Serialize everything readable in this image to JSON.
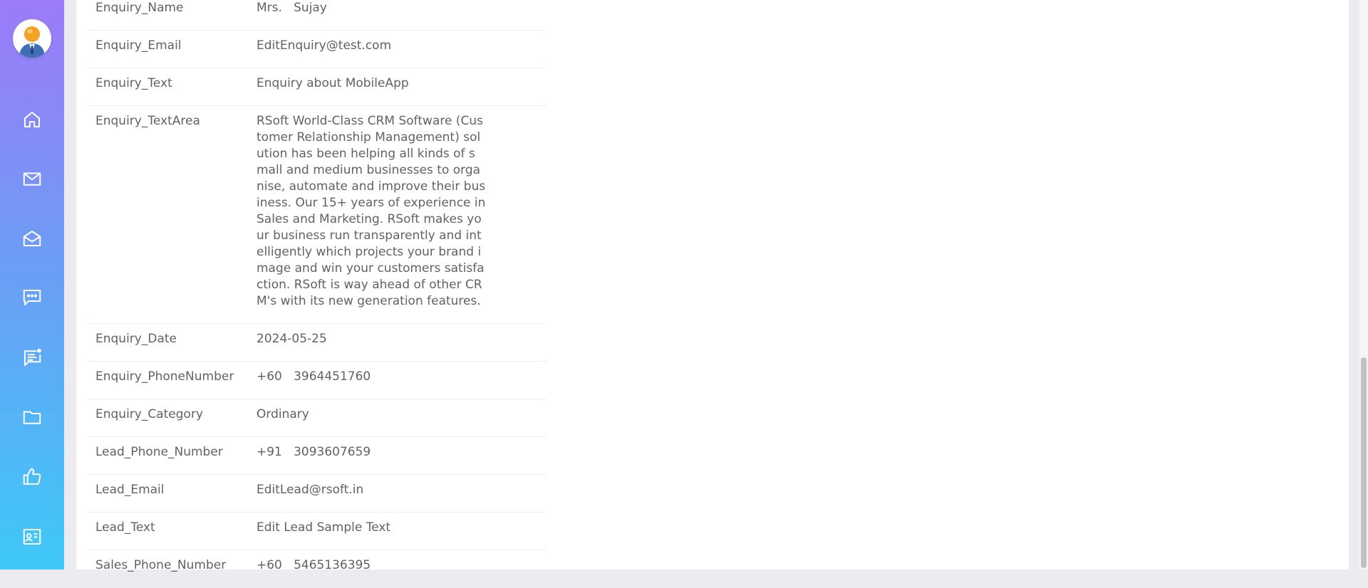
{
  "sidebar": {
    "nav": [
      {
        "icon": "home-icon"
      },
      {
        "icon": "mail-icon"
      },
      {
        "icon": "mail-open-icon"
      },
      {
        "icon": "chat-bubble-icon"
      },
      {
        "icon": "message-notification-icon"
      },
      {
        "icon": "folder-icon"
      },
      {
        "icon": "thumbs-up-icon"
      },
      {
        "icon": "contact-card-icon"
      }
    ]
  },
  "details": [
    {
      "label": "Enquiry_Name",
      "value": "Mrs.   Sujay"
    },
    {
      "label": "Enquiry_Email",
      "value": "EditEnquiry@test.com"
    },
    {
      "label": "Enquiry_Text",
      "value": "Enquiry about MobileApp"
    },
    {
      "label": "Enquiry_TextArea",
      "value": "RSoft World-Class CRM Software (Customer Relationship Management) solution has been helping all kinds of small and medium businesses to organise, automate and improve their business. Our 15+ years of experience in Sales and Marketing. RSoft makes your business run transparently and intelligently which projects your brand image and win your customers satisfaction. RSoft is way ahead of other CRM's with its new generation features."
    },
    {
      "label": "Enquiry_Date",
      "value": "2024-05-25"
    },
    {
      "label": "Enquiry_PhoneNumber",
      "value": "+60   3964451760"
    },
    {
      "label": "Enquiry_Category",
      "value": "Ordinary"
    },
    {
      "label": "Lead_Phone_Number",
      "value": "+91   3093607659"
    },
    {
      "label": "Lead_Email",
      "value": "EditLead@rsoft.in"
    },
    {
      "label": "Lead_Text",
      "value": "Edit Lead Sample Text"
    },
    {
      "label": "Sales_Phone_Number",
      "value": "+60   5465136395"
    }
  ]
}
